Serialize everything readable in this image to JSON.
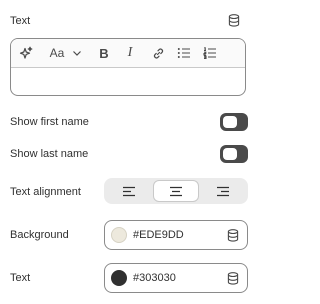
{
  "text_section": {
    "label": "Text",
    "source_icon": "database-icon",
    "editor": {
      "toolbar": {
        "ai_icon": "sparkles-icon",
        "font_style_glyph": "Aa",
        "dropdown_icon": "chevron-down-icon",
        "bold_glyph": "B",
        "italic_glyph": "I",
        "link_icon": "link-icon",
        "bullet_list_icon": "bullet-list-icon",
        "numbered_list_icon": "numbered-list-icon"
      },
      "value": ""
    }
  },
  "toggles": [
    {
      "label": "Show first name",
      "on": false
    },
    {
      "label": "Show last name",
      "on": false
    }
  ],
  "alignment": {
    "label": "Text alignment",
    "options": [
      "left",
      "center",
      "right"
    ],
    "selected": "center"
  },
  "background": {
    "label": "Background",
    "value": "#EDE9DD",
    "swatch": "#EDE9DD"
  },
  "text_color": {
    "label": "Text",
    "value": "#303030",
    "swatch": "#303030"
  },
  "colors": {
    "text": "#303030",
    "border": "#8a8a8a",
    "toggle_off": "#4a4a4a",
    "segment_bg": "#ebebeb"
  }
}
